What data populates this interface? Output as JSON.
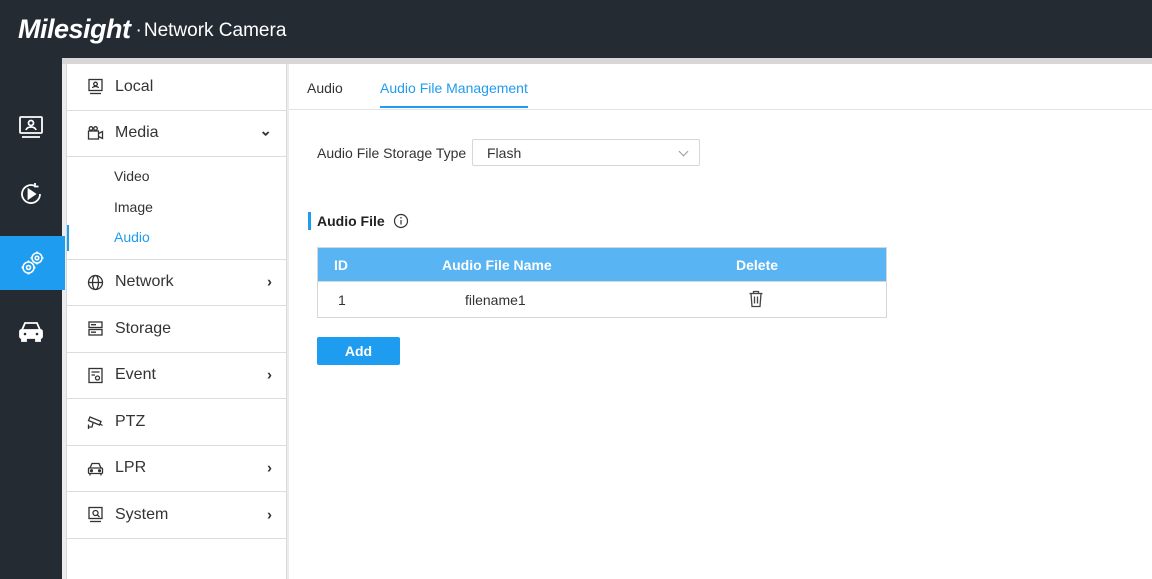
{
  "header": {
    "brand": "Milesight",
    "product_dot": "·",
    "product": "Network Camera"
  },
  "rail": [
    {
      "icon": "live-view-icon"
    },
    {
      "icon": "playback-icon"
    },
    {
      "icon": "settings-icon",
      "active": true
    },
    {
      "icon": "vehicle-icon"
    }
  ],
  "menu": {
    "local": "Local",
    "media": "Media",
    "media_chevron": "⌄",
    "submenu": {
      "video": "Video",
      "image": "Image",
      "audio": "Audio"
    },
    "network": "Network",
    "storage": "Storage",
    "event": "Event",
    "ptz": "PTZ",
    "lpr": "LPR",
    "system": "System",
    "chevron": "›"
  },
  "tabs": {
    "audio": "Audio",
    "audio_file_management": "Audio File Management"
  },
  "form": {
    "storage_type_label": "Audio File Storage Type",
    "storage_type_value": "Flash"
  },
  "section": {
    "title": "Audio File"
  },
  "table": {
    "columns": [
      "ID",
      "Audio File Name",
      "Delete"
    ],
    "rows": [
      {
        "id": "1",
        "name": "filename1"
      }
    ]
  },
  "buttons": {
    "add": "Add"
  },
  "colors": {
    "accent": "#1e9cf0",
    "header_bg": "#252b33",
    "table_header": "#58b4f2"
  }
}
